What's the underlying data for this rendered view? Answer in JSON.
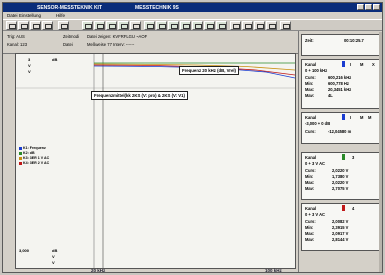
{
  "title": {
    "app": "SENSOR-MESSTEKNIK KIT",
    "doc": "MESSTECHNIK 9S"
  },
  "menu": [
    "Datei",
    "Einstellung",
    "Hilfe"
  ],
  "info": {
    "l1": "Trig: AUS",
    "l2": "Kanal: 123",
    "m1": "Zeitmodi",
    "m2": "Datei",
    "r1": "Datei zeigen: KVFRFLGU ~AOF",
    "r2": "Meßweise 77   Interv: ------"
  },
  "plot": {
    "y_top_labels": [
      "3",
      "V",
      "V"
    ],
    "y_top_unit": "dB",
    "y_bot_value": "3,000",
    "y_bot_unit": "dB",
    "y_bot_labels": [
      "V",
      "V"
    ],
    "tooltip1": "Frequenzmittel(kk 2KS (V: pro) & 2KS (V: V1)",
    "tooltip2": "Frequenz 20 kHz (dB, Vrel)",
    "x_start": "20 kHz",
    "x_end": "100 kHz",
    "legend": [
      {
        "label": "K1: Frequenz",
        "color": "#1a3cd0"
      },
      {
        "label": "K2: dB",
        "color": "#2a8a2a"
      },
      {
        "label": "K3: 3ER 1 V AC",
        "color": "#c89010"
      },
      {
        "label": "K4: 3ER 2 V AC",
        "color": "#c01818"
      }
    ]
  },
  "side": {
    "zeit_label": "Zeit:",
    "zeit_value": "00:10:25.7",
    "p1": {
      "h1": "Kanal",
      "h2": "I",
      "h3": "M",
      "h4": "X",
      "sub": "0 + 100 kHz",
      "rows": [
        [
          "Curs:",
          "600,216 kHz"
        ],
        [
          "Min:",
          "600,778 Hz"
        ],
        [
          "Max:",
          "20,3451 kHz"
        ],
        [
          "Mav:",
          "4L"
        ]
      ]
    },
    "p2": {
      "h1": "Kanal",
      "h2": "I",
      "h3": "M",
      "h4": "M",
      "sub": "-3,000 + 0 dB",
      "rows": [
        [
          "Curs:",
          "-12,04580 m"
        ]
      ]
    },
    "p3": {
      "h1": "Kanal",
      "h2": "3",
      "sub": "0 + 3  V AC",
      "rows": [
        [
          "Curs:",
          "2,0220 V"
        ],
        [
          "Min:",
          "1,7380 V"
        ],
        [
          "Max:",
          "2,0220 V"
        ],
        [
          "Mav:",
          "2,7075 V"
        ]
      ]
    },
    "p4": {
      "h1": "Kanal",
      "h2": "4",
      "sub": "0 + 3  V AC",
      "rows": [
        [
          "Curs:",
          "2,0082 V"
        ],
        [
          "Min:",
          "2,3915 V"
        ],
        [
          "Max:",
          "2,0917 V"
        ],
        [
          "Mav:",
          "2,8144 V"
        ]
      ]
    }
  },
  "colors": {
    "blue": "#1a3cd0",
    "green": "#2a8a2a",
    "orange": "#c89010",
    "red": "#c01818"
  }
}
